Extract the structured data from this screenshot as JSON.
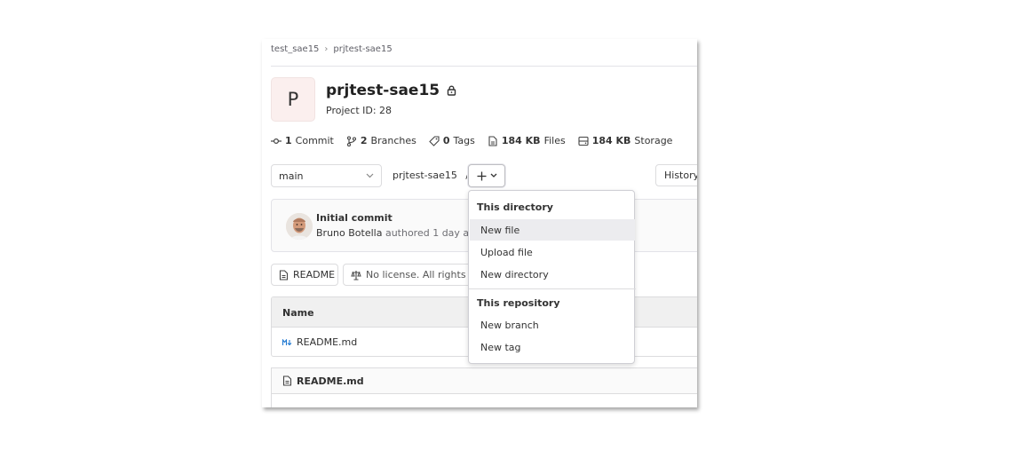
{
  "breadcrumb": {
    "group": "test_sae15",
    "project": "prjtest-sae15"
  },
  "project": {
    "avatar_letter": "P",
    "name": "prjtest-sae15",
    "id_label": "Project ID: 28"
  },
  "stats": [
    {
      "icon": "commit-icon",
      "value": "1",
      "label": "Commit"
    },
    {
      "icon": "branch-icon",
      "value": "2",
      "label": "Branches"
    },
    {
      "icon": "tag-icon",
      "value": "0",
      "label": "Tags"
    },
    {
      "icon": "file-icon",
      "value": "184 KB",
      "label": "Files"
    },
    {
      "icon": "storage-icon",
      "value": "184 KB",
      "label": "Storage"
    }
  ],
  "repo_nav": {
    "branch": "main",
    "path": "prjtest-sae15",
    "path_sep": "/",
    "history_label": "History"
  },
  "commit": {
    "title": "Initial commit",
    "author": "Bruno Botella",
    "meta": "authored 1 day ago"
  },
  "buttons": {
    "readme": "README",
    "license": "No license. All rights reserved"
  },
  "files": {
    "header": "Name",
    "rows": [
      {
        "icon": "markdown-icon",
        "name": "README.md"
      }
    ]
  },
  "readme_header": "README.md",
  "dropdown": {
    "section1": "This directory",
    "section1_items": [
      "New file",
      "Upload file",
      "New directory"
    ],
    "section2": "This repository",
    "section2_items": [
      "New branch",
      "New tag"
    ],
    "highlighted": "New file"
  },
  "colors": {
    "avatar_bg": "#fbefee",
    "highlight": "#ececef",
    "markdown_icon": "#1f78d1"
  }
}
